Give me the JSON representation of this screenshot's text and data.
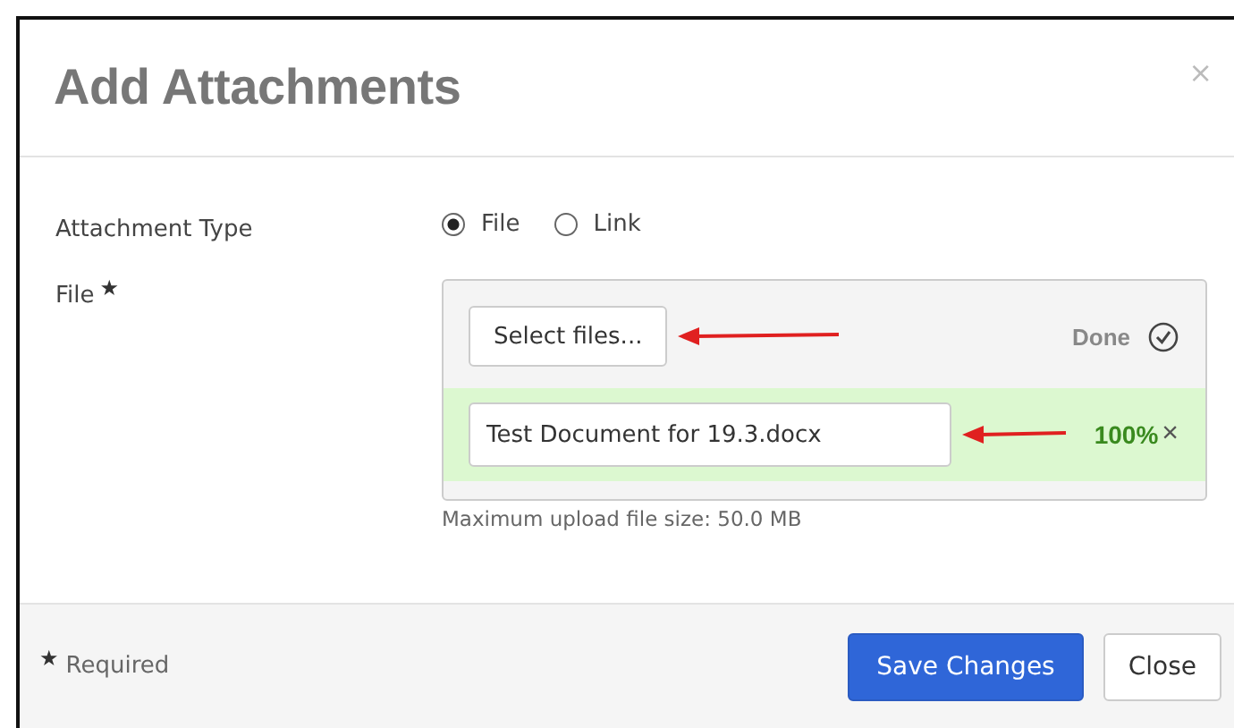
{
  "dialog": {
    "title": "Add Attachments",
    "close_glyph": "×"
  },
  "attachment_type": {
    "label": "Attachment Type",
    "options": [
      {
        "label": "File",
        "selected": true
      },
      {
        "label": "Link",
        "selected": false
      }
    ]
  },
  "file": {
    "label": "File",
    "required_mark": "★",
    "select_button": "Select files...",
    "status": "Done",
    "uploads": [
      {
        "name": "Test Document for 19.3.docx",
        "progress": "100%",
        "remove_glyph": "×"
      }
    ],
    "hint": "Maximum upload file size: 50.0 MB"
  },
  "footer": {
    "required_mark": "★",
    "required_note": "Required",
    "buttons": [
      {
        "label": "Save Changes",
        "kind": "primary"
      },
      {
        "label": "Close",
        "kind": "default"
      }
    ]
  }
}
